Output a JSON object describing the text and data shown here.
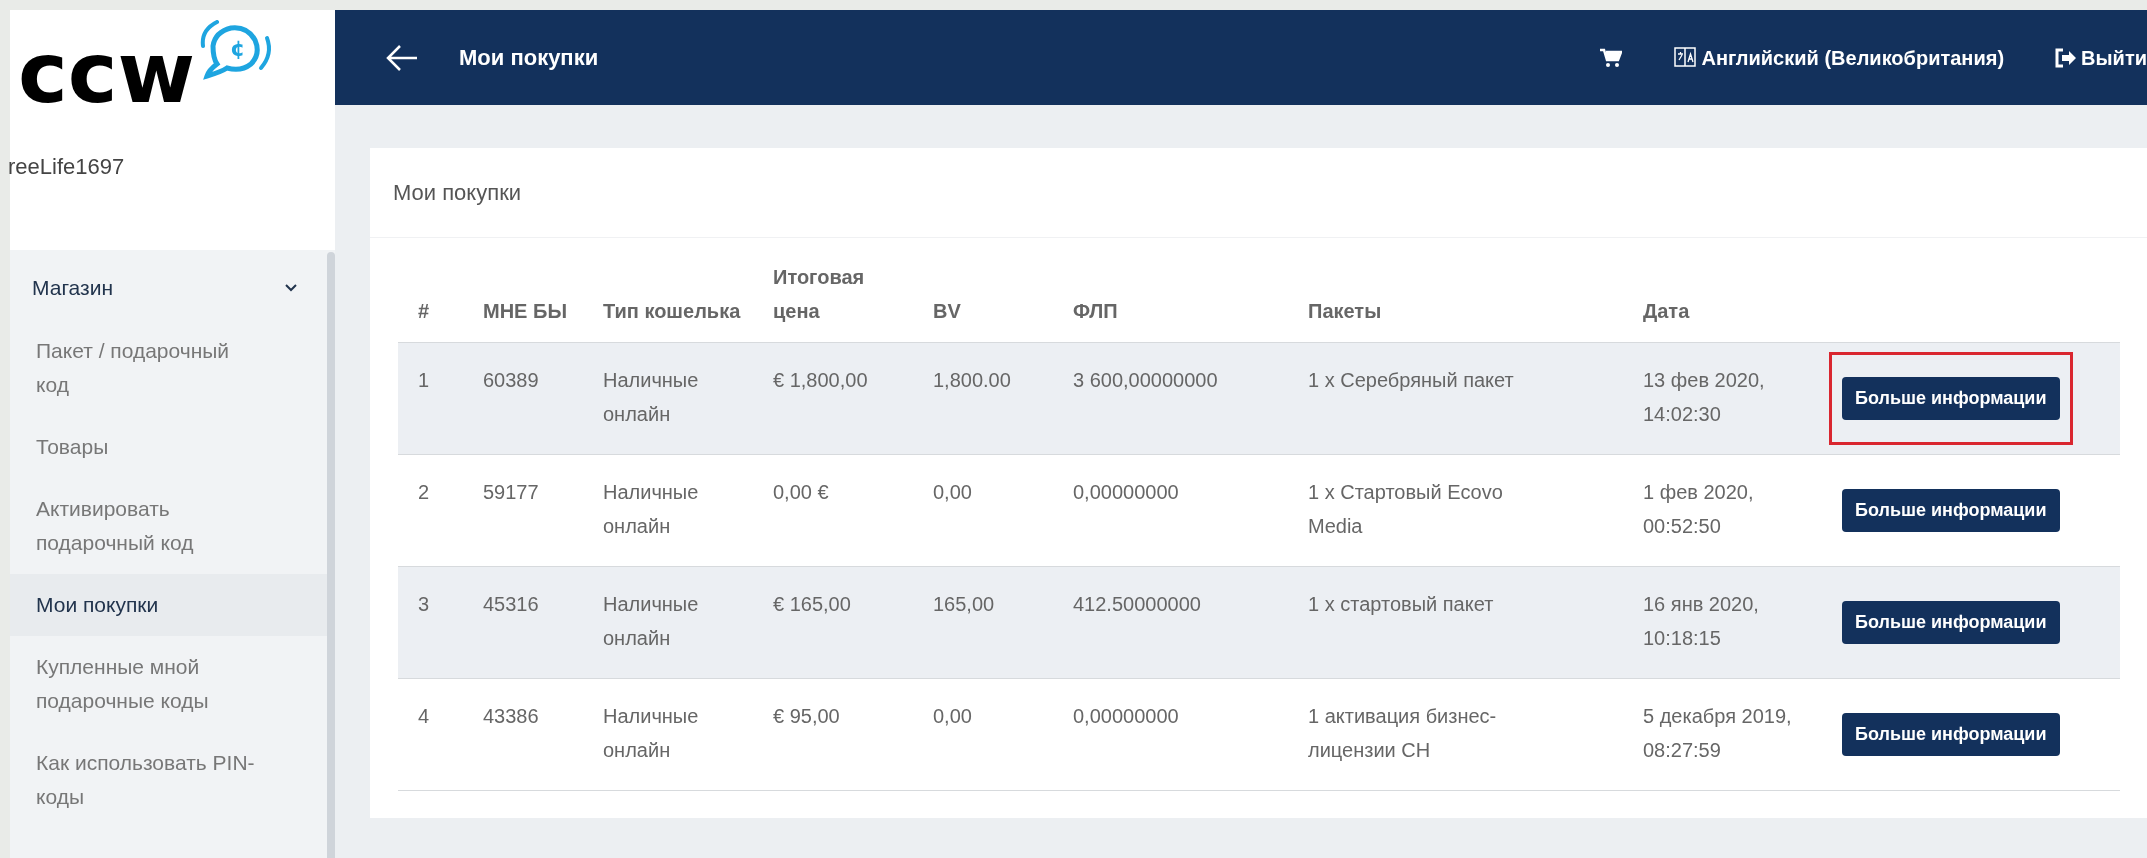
{
  "logo": {
    "text": "ccw",
    "badge": "¢"
  },
  "user": {
    "name": "reeLife1697"
  },
  "sidebar": {
    "items": [
      {
        "label": "Магазин",
        "kind": "group",
        "expanded": true,
        "selected": false
      },
      {
        "label": "Пакет / подарочный код",
        "kind": "item",
        "selected": false
      },
      {
        "label": "Товары",
        "kind": "item",
        "selected": false
      },
      {
        "label": "Активировать подарочный код",
        "kind": "item",
        "selected": false
      },
      {
        "label": "Мои покупки",
        "kind": "item",
        "selected": true
      },
      {
        "label": "Купленные мной подарочные коды",
        "kind": "item",
        "selected": false
      },
      {
        "label": "Как использовать PIN-коды",
        "kind": "item",
        "selected": false
      }
    ]
  },
  "header": {
    "title": "Мои покупки",
    "language": "Английский (Великобритания)",
    "logout": "Выйти"
  },
  "card": {
    "title": "Мои покупки"
  },
  "table": {
    "columns": [
      "#",
      "МНЕ БЫ",
      "Тип кошелька",
      "Итоговая цена",
      "BV",
      "ФЛП",
      "Пакеты",
      "Дата"
    ],
    "rows": [
      {
        "cells": [
          "1",
          "60389",
          "Наличные онлайн",
          "€ 1,800,00",
          "1,800.00",
          "3 600,00000000",
          "1 x Серебряный пакет",
          "13 фев 2020, 14:02:30"
        ],
        "button": "Больше информации",
        "highlighted": true
      },
      {
        "cells": [
          "2",
          "59177",
          "Наличные онлайн",
          "0,00 €",
          "0,00",
          "0,00000000",
          "1 x Стартовый Ecovo Media",
          "1 фев 2020, 00:52:50"
        ],
        "button": "Больше информации",
        "highlighted": false
      },
      {
        "cells": [
          "3",
          "45316",
          "Наличные онлайн",
          "€ 165,00",
          "165,00",
          "412.50000000",
          "1 x стартовый пакет",
          "16 янв 2020, 10:18:15"
        ],
        "button": "Больше информации",
        "highlighted": false
      },
      {
        "cells": [
          "4",
          "43386",
          "Наличные онлайн",
          "€ 95,00",
          "0,00",
          "0,00000000",
          "1 активация бизнес-лицензии CH",
          "5 декабря 2019, 08:27:59"
        ],
        "button": "Больше информации",
        "highlighted": false
      }
    ]
  }
}
